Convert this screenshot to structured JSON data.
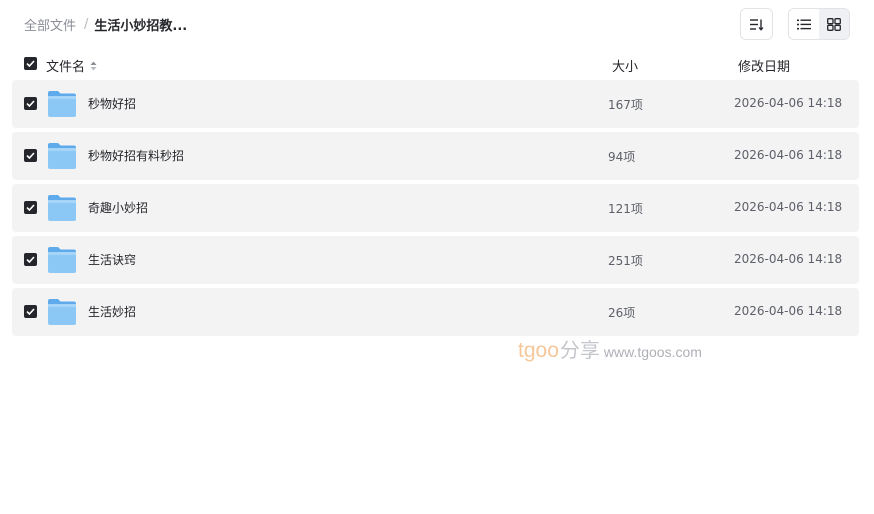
{
  "breadcrumb": {
    "root": "全部文件",
    "separator": "/",
    "current": "生活小妙招教..."
  },
  "toolbar": {
    "sort_icon": "sort-descending-icon",
    "view_modes": [
      "list-view-icon",
      "grid-view-icon"
    ],
    "active_view": "grid"
  },
  "table": {
    "columns": {
      "name": "文件名",
      "size": "大小",
      "date": "修改日期"
    },
    "rows": [
      {
        "name": "秒物好招",
        "size": "167项",
        "date": "2026-04-06 14:18",
        "checked": true
      },
      {
        "name": "秒物好招有料秒招",
        "size": "94项",
        "date": "2026-04-06 14:18",
        "checked": true
      },
      {
        "name": "奇趣小妙招",
        "size": "121项",
        "date": "2026-04-06 14:18",
        "checked": true
      },
      {
        "name": "生活诀窍",
        "size": "251项",
        "date": "2026-04-06 14:18",
        "checked": true
      },
      {
        "name": "生活妙招",
        "size": "26项",
        "date": "2026-04-06 14:18",
        "checked": true
      }
    ]
  },
  "watermark": {
    "brand": "tgoo",
    "share": "分享",
    "url": "www.tgoos.com"
  },
  "colors": {
    "row_background": "#f3f3f4",
    "checkbox": "#25262b",
    "folder": "#7ec0f2",
    "watermark_brand": "#f6c79a"
  }
}
